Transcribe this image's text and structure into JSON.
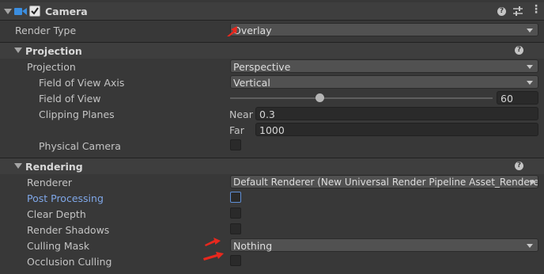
{
  "component": {
    "title": "Camera",
    "enabled": true,
    "icons": [
      "camera-icon",
      "help-icon",
      "presets-icon",
      "more-icon"
    ]
  },
  "render_type": {
    "label": "Render Type",
    "value": "Overlay"
  },
  "projection": {
    "header": "Projection",
    "projection_label": "Projection",
    "projection_value": "Perspective",
    "fov_axis_label": "Field of View Axis",
    "fov_axis_value": "Vertical",
    "fov_label": "Field of View",
    "fov_value": "60",
    "clipping_label": "Clipping Planes",
    "near_label": "Near",
    "near_value": "0.3",
    "far_label": "Far",
    "far_value": "1000",
    "physical_label": "Physical Camera"
  },
  "rendering": {
    "header": "Rendering",
    "renderer_label": "Renderer",
    "renderer_value": "Default Renderer (New Universal Render Pipeline Asset_Renderer)",
    "post_label": "Post Processing",
    "clear_depth_label": "Clear Depth",
    "render_shadows_label": "Render Shadows",
    "culling_mask_label": "Culling Mask",
    "culling_mask_value": "Nothing",
    "occlusion_label": "Occlusion Culling"
  },
  "colors": {
    "background": "#383838",
    "accent_blue": "#7fa7e8",
    "annotation_red": "#e8281e"
  }
}
